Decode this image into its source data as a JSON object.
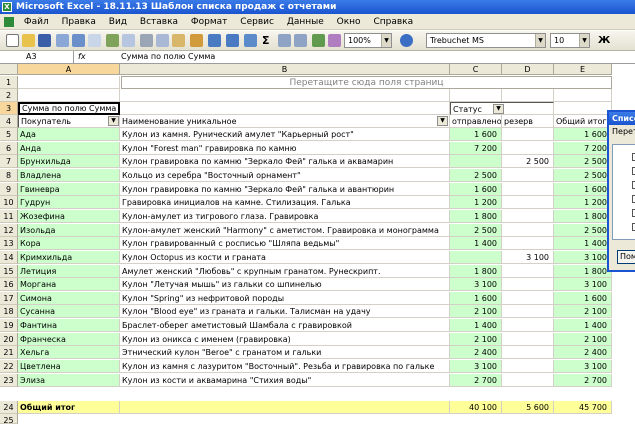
{
  "window": {
    "title": "Microsoft Excel - 18.11.13 Шаблон списка продаж с отчетами"
  },
  "menu": [
    "Файл",
    "Правка",
    "Вид",
    "Вставка",
    "Формат",
    "Сервис",
    "Данные",
    "Окно",
    "Справка"
  ],
  "toolbar": {
    "zoom": "100%",
    "font": "Trebuchet MS",
    "size": "10"
  },
  "formula": {
    "cell": "A3",
    "fx": "fx",
    "content": "Сумма по полю Сумма"
  },
  "columns": [
    "A",
    "B",
    "C",
    "D",
    "E"
  ],
  "sheet": {
    "drop_page_fields": "Перетащите сюда поля страниц",
    "pivot_label": "Сумма по полю Сумма",
    "status_label": "Статус",
    "buyer_header": "Покупатель",
    "item_header": "Наименование уникальное",
    "col_sent": "отправлено",
    "col_reserve": "резерв",
    "col_total": "Общий итог",
    "rows": [
      {
        "n": "5",
        "a": "Ада",
        "b": "Кулон из камня. Рунический амулет \"Карьерный рост\"",
        "c": "1 600",
        "d": "",
        "e": "1 600"
      },
      {
        "n": "6",
        "a": "Анда",
        "b": "Кулон \"Forest man\" гравировка по камню",
        "c": "7 200",
        "d": "",
        "e": "7 200"
      },
      {
        "n": "7",
        "a": "Брунхильда",
        "b": "Кулон гравировка по камню \"Зеркало Фей\" галька и аквамарин",
        "c": "",
        "d": "2 500",
        "e": "2 500"
      },
      {
        "n": "8",
        "a": "Владлена",
        "b": "Кольцо из серебра \"Восточный орнамент\"",
        "c": "2 500",
        "d": "",
        "e": "2 500"
      },
      {
        "n": "9",
        "a": "Гвиневра",
        "b": "Кулон гравировка по камню \"Зеркало Фей\" галька и авантюрин",
        "c": "1 600",
        "d": "",
        "e": "1 600"
      },
      {
        "n": "10",
        "a": "Гудрун",
        "b": "Гравировка инициалов на камне. Стилизация. Галька",
        "c": "1 200",
        "d": "",
        "e": "1 200"
      },
      {
        "n": "11",
        "a": "Жозефина",
        "b": "Кулон-амулет из тигрового глаза. Гравировка",
        "c": "1 800",
        "d": "",
        "e": "1 800"
      },
      {
        "n": "12",
        "a": "Изольда",
        "b": "Кулон-амулет женский \"Harmony\" с аметистом. Гравировка и монограмма",
        "c": "2 500",
        "d": "",
        "e": "2 500"
      },
      {
        "n": "13",
        "a": "Кора",
        "b": "Кулон гравированный с росписью \"Шляпа ведьмы\"",
        "c": "1 400",
        "d": "",
        "e": "1 400"
      },
      {
        "n": "14",
        "a": "Кримхильда",
        "b": "Кулон Octopus из кости и граната",
        "c": "",
        "d": "3 100",
        "e": "3 100"
      },
      {
        "n": "15",
        "a": "Летиция",
        "b": "Амулет женский \"Любовь\" с крупным гранатом. Рунескрипт.",
        "c": "1 800",
        "d": "",
        "e": "1 800"
      },
      {
        "n": "16",
        "a": "Моргана",
        "b": "Кулон \"Летучая мышь\" из гальки со шпинелью",
        "c": "3 100",
        "d": "",
        "e": "3 100"
      },
      {
        "n": "17",
        "a": "Симона",
        "b": "Кулон \"Spring\" из нефритовой породы",
        "c": "1 600",
        "d": "",
        "e": "1 600"
      },
      {
        "n": "18",
        "a": "Сусанна",
        "b": "Кулон \"Blood eye\" из граната и гальки. Талисман на удачу",
        "c": "2 100",
        "d": "",
        "e": "2 100"
      },
      {
        "n": "19",
        "a": "Фантина",
        "b": "Браслет-оберег аметистовый Шамбала с гравировкой",
        "c": "1 400",
        "d": "",
        "e": "1 400"
      },
      {
        "n": "20",
        "a": "Франческа",
        "b": "Кулон из оникса с именем (гравировка)",
        "c": "2 100",
        "d": "",
        "e": "2 100"
      },
      {
        "n": "21",
        "a": "Хельга",
        "b": "Этнический кулон \"Berое\" с гранатом и гальки",
        "c": "2 400",
        "d": "",
        "e": "2 400"
      },
      {
        "n": "22",
        "a": "Цветлена",
        "b": "Кулон из камня с лазуритом \"Восточный\". Резьба и гравировка по гальке",
        "c": "3 100",
        "d": "",
        "e": "3 100"
      },
      {
        "n": "23",
        "a": "Элиза",
        "b": "Кулон из кости и аквамарина \"Стихия воды\"",
        "c": "2 700",
        "d": "",
        "e": "2 700"
      }
    ],
    "total": {
      "n": "24",
      "a": "Общий итог",
      "c": "40 100",
      "d": "5 600",
      "e": "45 700"
    }
  },
  "panel": {
    "title": "Список",
    "subtitle": "Перет",
    "button": "Пом"
  }
}
